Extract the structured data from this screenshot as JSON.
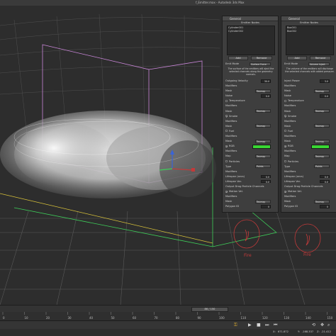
{
  "window": {
    "title": "f_Emitter.max - Autodesk 3ds Max"
  },
  "timeline": {
    "frame_label": "86 / 150",
    "ticks": [
      "0",
      "10",
      "20",
      "30",
      "40",
      "50",
      "60",
      "70",
      "80",
      "90",
      "100",
      "110",
      "120",
      "130",
      "140",
      "150"
    ]
  },
  "status": {
    "x_value": "671.872",
    "y_value": "-168.337",
    "z_value": "-21.412"
  },
  "viewport": {
    "fire_gizmo_label": "Fire",
    "colors": {
      "grid": "#5c5c5c",
      "bbox_purple": "#c986d8",
      "bbox_green": "#3ecf5a",
      "gizmo_red": "#c23a3a",
      "smoke": "#d9d9d9"
    }
  },
  "panels": [
    {
      "rollout_title": "General",
      "list_header": "Emitter Nodes",
      "nodes": [
        "Cylinder001",
        "Cylinder002"
      ],
      "add_label": "Add",
      "remove_label": "Remove",
      "emit_mode_label": "Emit Mode",
      "emit_mode_value": "Surface Force",
      "description": "The surface of the emitters will eject the selected channels along the geometry normals.",
      "outgoing_label": "Outgoing Velocity",
      "outgoing_value": "30.0",
      "rows": [
        {
          "label": "Modifiers",
          "type": "header"
        },
        {
          "label": "Mask",
          "type": "dd",
          "value": "Texmap"
        },
        {
          "label": "Noise",
          "type": "field",
          "value": "0.0"
        },
        {
          "label": "Temperature",
          "type": "chk",
          "checked": false
        },
        {
          "label": "Modifiers",
          "type": "header"
        },
        {
          "label": "Mask",
          "type": "dd",
          "value": "Texmap"
        },
        {
          "label": "Smoke",
          "type": "chk",
          "checked": true
        },
        {
          "label": "Modifiers",
          "type": "header"
        },
        {
          "label": "Mask",
          "type": "dd",
          "value": "Texmap"
        },
        {
          "label": "Fuel",
          "type": "chk",
          "checked": false
        },
        {
          "label": "Modifiers",
          "type": "header"
        },
        {
          "label": "Mask",
          "type": "dd",
          "value": "Texmap"
        },
        {
          "label": "RGB",
          "type": "color",
          "checked": true
        },
        {
          "label": "Modifiers",
          "type": "header"
        },
        {
          "label": "Map",
          "type": "dd",
          "value": "Texmap"
        },
        {
          "label": "Particles",
          "type": "chk",
          "checked": false
        },
        {
          "label": "Type",
          "type": "dd",
          "value": "Points"
        },
        {
          "label": "Modifiers",
          "type": "header"
        },
        {
          "label": "Lifespan (secs)",
          "type": "field",
          "value": "0.0"
        },
        {
          "label": "Lifespan Var.",
          "type": "field",
          "value": "0.0"
        },
        {
          "label": "Output Drag Particle Channels",
          "type": "header"
        },
        {
          "label": "Motion Vel.",
          "type": "chk",
          "checked": true
        },
        {
          "label": "Modifiers",
          "type": "header"
        },
        {
          "label": "Mask",
          "type": "dd",
          "value": "Texmap"
        },
        {
          "label": "Polygon ID",
          "type": "field",
          "value": "0"
        }
      ]
    },
    {
      "rollout_title": "General",
      "list_header": "Emitter Nodes",
      "nodes": [
        "Box001",
        "Box002"
      ],
      "add_label": "Add",
      "remove_label": "Remove",
      "emit_mode_label": "Emit Mode",
      "emit_mode_value": "Volume Inject",
      "description": "The volume of the emitters will discharge the selected channels with added pressure.",
      "outgoing_label": "Inject Power",
      "outgoing_value": "3.0",
      "rows": [
        {
          "label": "Modifiers",
          "type": "header"
        },
        {
          "label": "Mask",
          "type": "dd",
          "value": "Texmap"
        },
        {
          "label": "Noise",
          "type": "field",
          "value": "0.0"
        },
        {
          "label": "Temperature",
          "type": "chk",
          "checked": false
        },
        {
          "label": "Modifiers",
          "type": "header"
        },
        {
          "label": "Mask",
          "type": "dd",
          "value": "Texmap"
        },
        {
          "label": "Smoke",
          "type": "chk",
          "checked": true
        },
        {
          "label": "Modifiers",
          "type": "header"
        },
        {
          "label": "Mask",
          "type": "dd",
          "value": "Texmap"
        },
        {
          "label": "Fuel",
          "type": "chk",
          "checked": false
        },
        {
          "label": "Modifiers",
          "type": "header"
        },
        {
          "label": "Mask",
          "type": "dd",
          "value": "Texmap"
        },
        {
          "label": "RGB",
          "type": "color",
          "checked": true
        },
        {
          "label": "Modifiers",
          "type": "header"
        },
        {
          "label": "Map",
          "type": "dd",
          "value": "Texmap"
        },
        {
          "label": "Particles",
          "type": "chk",
          "checked": false
        },
        {
          "label": "Type",
          "type": "dd",
          "value": "Points"
        },
        {
          "label": "Modifiers",
          "type": "header"
        },
        {
          "label": "Lifespan (secs)",
          "type": "field",
          "value": "0.0"
        },
        {
          "label": "Lifespan Var.",
          "type": "field",
          "value": "0.0"
        },
        {
          "label": "Output Drag Particle Channels",
          "type": "header"
        },
        {
          "label": "Motion Vel.",
          "type": "chk",
          "checked": true
        },
        {
          "label": "Modifiers",
          "type": "header"
        },
        {
          "label": "Mask",
          "type": "dd",
          "value": "Texmap"
        },
        {
          "label": "Polygon ID",
          "type": "field",
          "value": "0"
        }
      ]
    }
  ]
}
